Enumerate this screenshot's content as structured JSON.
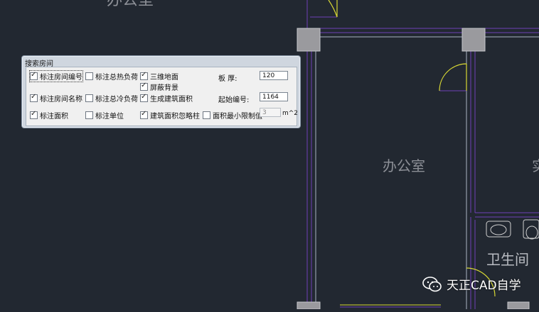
{
  "drawing": {
    "rooms": {
      "top_room": "办公室",
      "main_room": "办公室",
      "right_room_partial": "实",
      "washroom": "卫生间"
    },
    "watermark": "天正CAD自学"
  },
  "dialog": {
    "title": "搜索房间",
    "options": {
      "mark_room_number": "标注房间编号",
      "mark_room_name": "标注房间名称",
      "mark_area": "标注面积",
      "mark_total_heat_load": "标注总热负荷",
      "mark_total_cool_load": "标注总冷负荷",
      "mark_unit": "标注单位",
      "floor_3d": "三维地面",
      "mask_background": "屏蔽背景",
      "generate_building_area": "生成建筑面积",
      "building_area_ignore_columns": "建筑面积忽略柱",
      "area_min_limit": "面积最小限制值"
    },
    "checked": {
      "mark_room_number": true,
      "mark_room_name": true,
      "mark_area": true,
      "mark_total_heat_load": false,
      "mark_total_cool_load": false,
      "mark_unit": false,
      "floor_3d": true,
      "mask_background": true,
      "generate_building_area": true,
      "building_area_ignore_columns": true,
      "area_min_limit": false
    },
    "fields": {
      "slab_thickness_label": "板    厚:",
      "slab_thickness_value": "120",
      "start_number_label": "起始编号:",
      "start_number_value": "1164",
      "min_area_value": "3",
      "min_area_unit": "m^2"
    }
  },
  "colors": {
    "canvas_bg": "#222831",
    "wall_line": "#6f3fb8",
    "wall_line_light": "#a9b4c4",
    "column_fill": "#9a9a9e",
    "door_arc": "#d8d834"
  }
}
